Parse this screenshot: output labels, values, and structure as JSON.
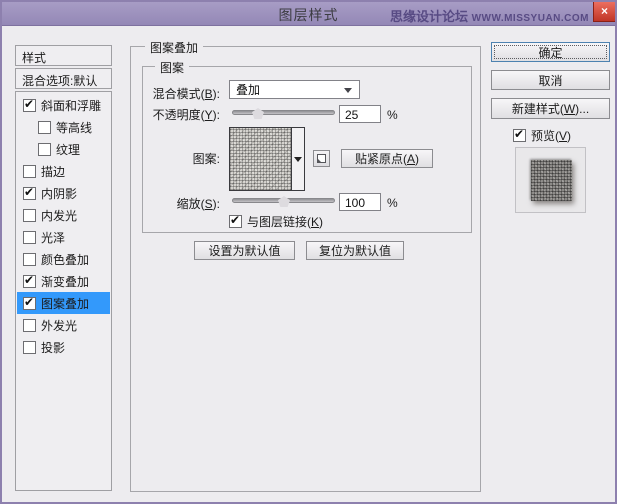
{
  "titlebar": {
    "title": "图层样式",
    "watermark_name": "思缘设计论坛 ",
    "watermark_url": "WWW.MISSYUAN.COM",
    "close_glyph": "×"
  },
  "colors": {
    "titlebar_purple": "#9488b6",
    "dialog_border": "#8d80ae",
    "selection_blue": "#3399fb",
    "close_red": "#c03527"
  },
  "sidebar": {
    "styles_label": "样式",
    "blend_options_label": "混合选项:默认",
    "effects": [
      {
        "label": "斜面和浮雕",
        "check": "✔"
      },
      {
        "label": "等高线",
        "check": ""
      },
      {
        "label": "纹理",
        "check": ""
      },
      {
        "label": "描边",
        "check": ""
      },
      {
        "label": "内阴影",
        "check": "✔"
      },
      {
        "label": "内发光",
        "check": ""
      },
      {
        "label": "光泽",
        "check": ""
      },
      {
        "label": "颜色叠加",
        "check": ""
      },
      {
        "label": "渐变叠加",
        "check": "✔"
      },
      {
        "label": "图案叠加",
        "check": "✔"
      },
      {
        "label": "外发光",
        "check": ""
      },
      {
        "label": "投影",
        "check": ""
      }
    ]
  },
  "main": {
    "group_title": "图案叠加",
    "subgroup_title": "图案",
    "blend_mode_label": "混合模式(B):",
    "blend_mode_value": "叠加",
    "opacity_label": "不透明度(Y):",
    "opacity_value": "25",
    "opacity_unit": "%",
    "pattern_label": "图案:",
    "snap_origin_button": "贴紧原点(A)",
    "scale_label": "缩放(S):",
    "scale_value": "100",
    "scale_unit": "%",
    "link_label": "与图层链接(K)",
    "link_check": "✔",
    "set_default_button": "设置为默认值",
    "reset_default_button": "复位为默认值"
  },
  "actions": {
    "ok": "确定",
    "cancel": "取消",
    "new_style": "新建样式(W)...",
    "preview_label": "预览(V)",
    "preview_check": "✔"
  }
}
